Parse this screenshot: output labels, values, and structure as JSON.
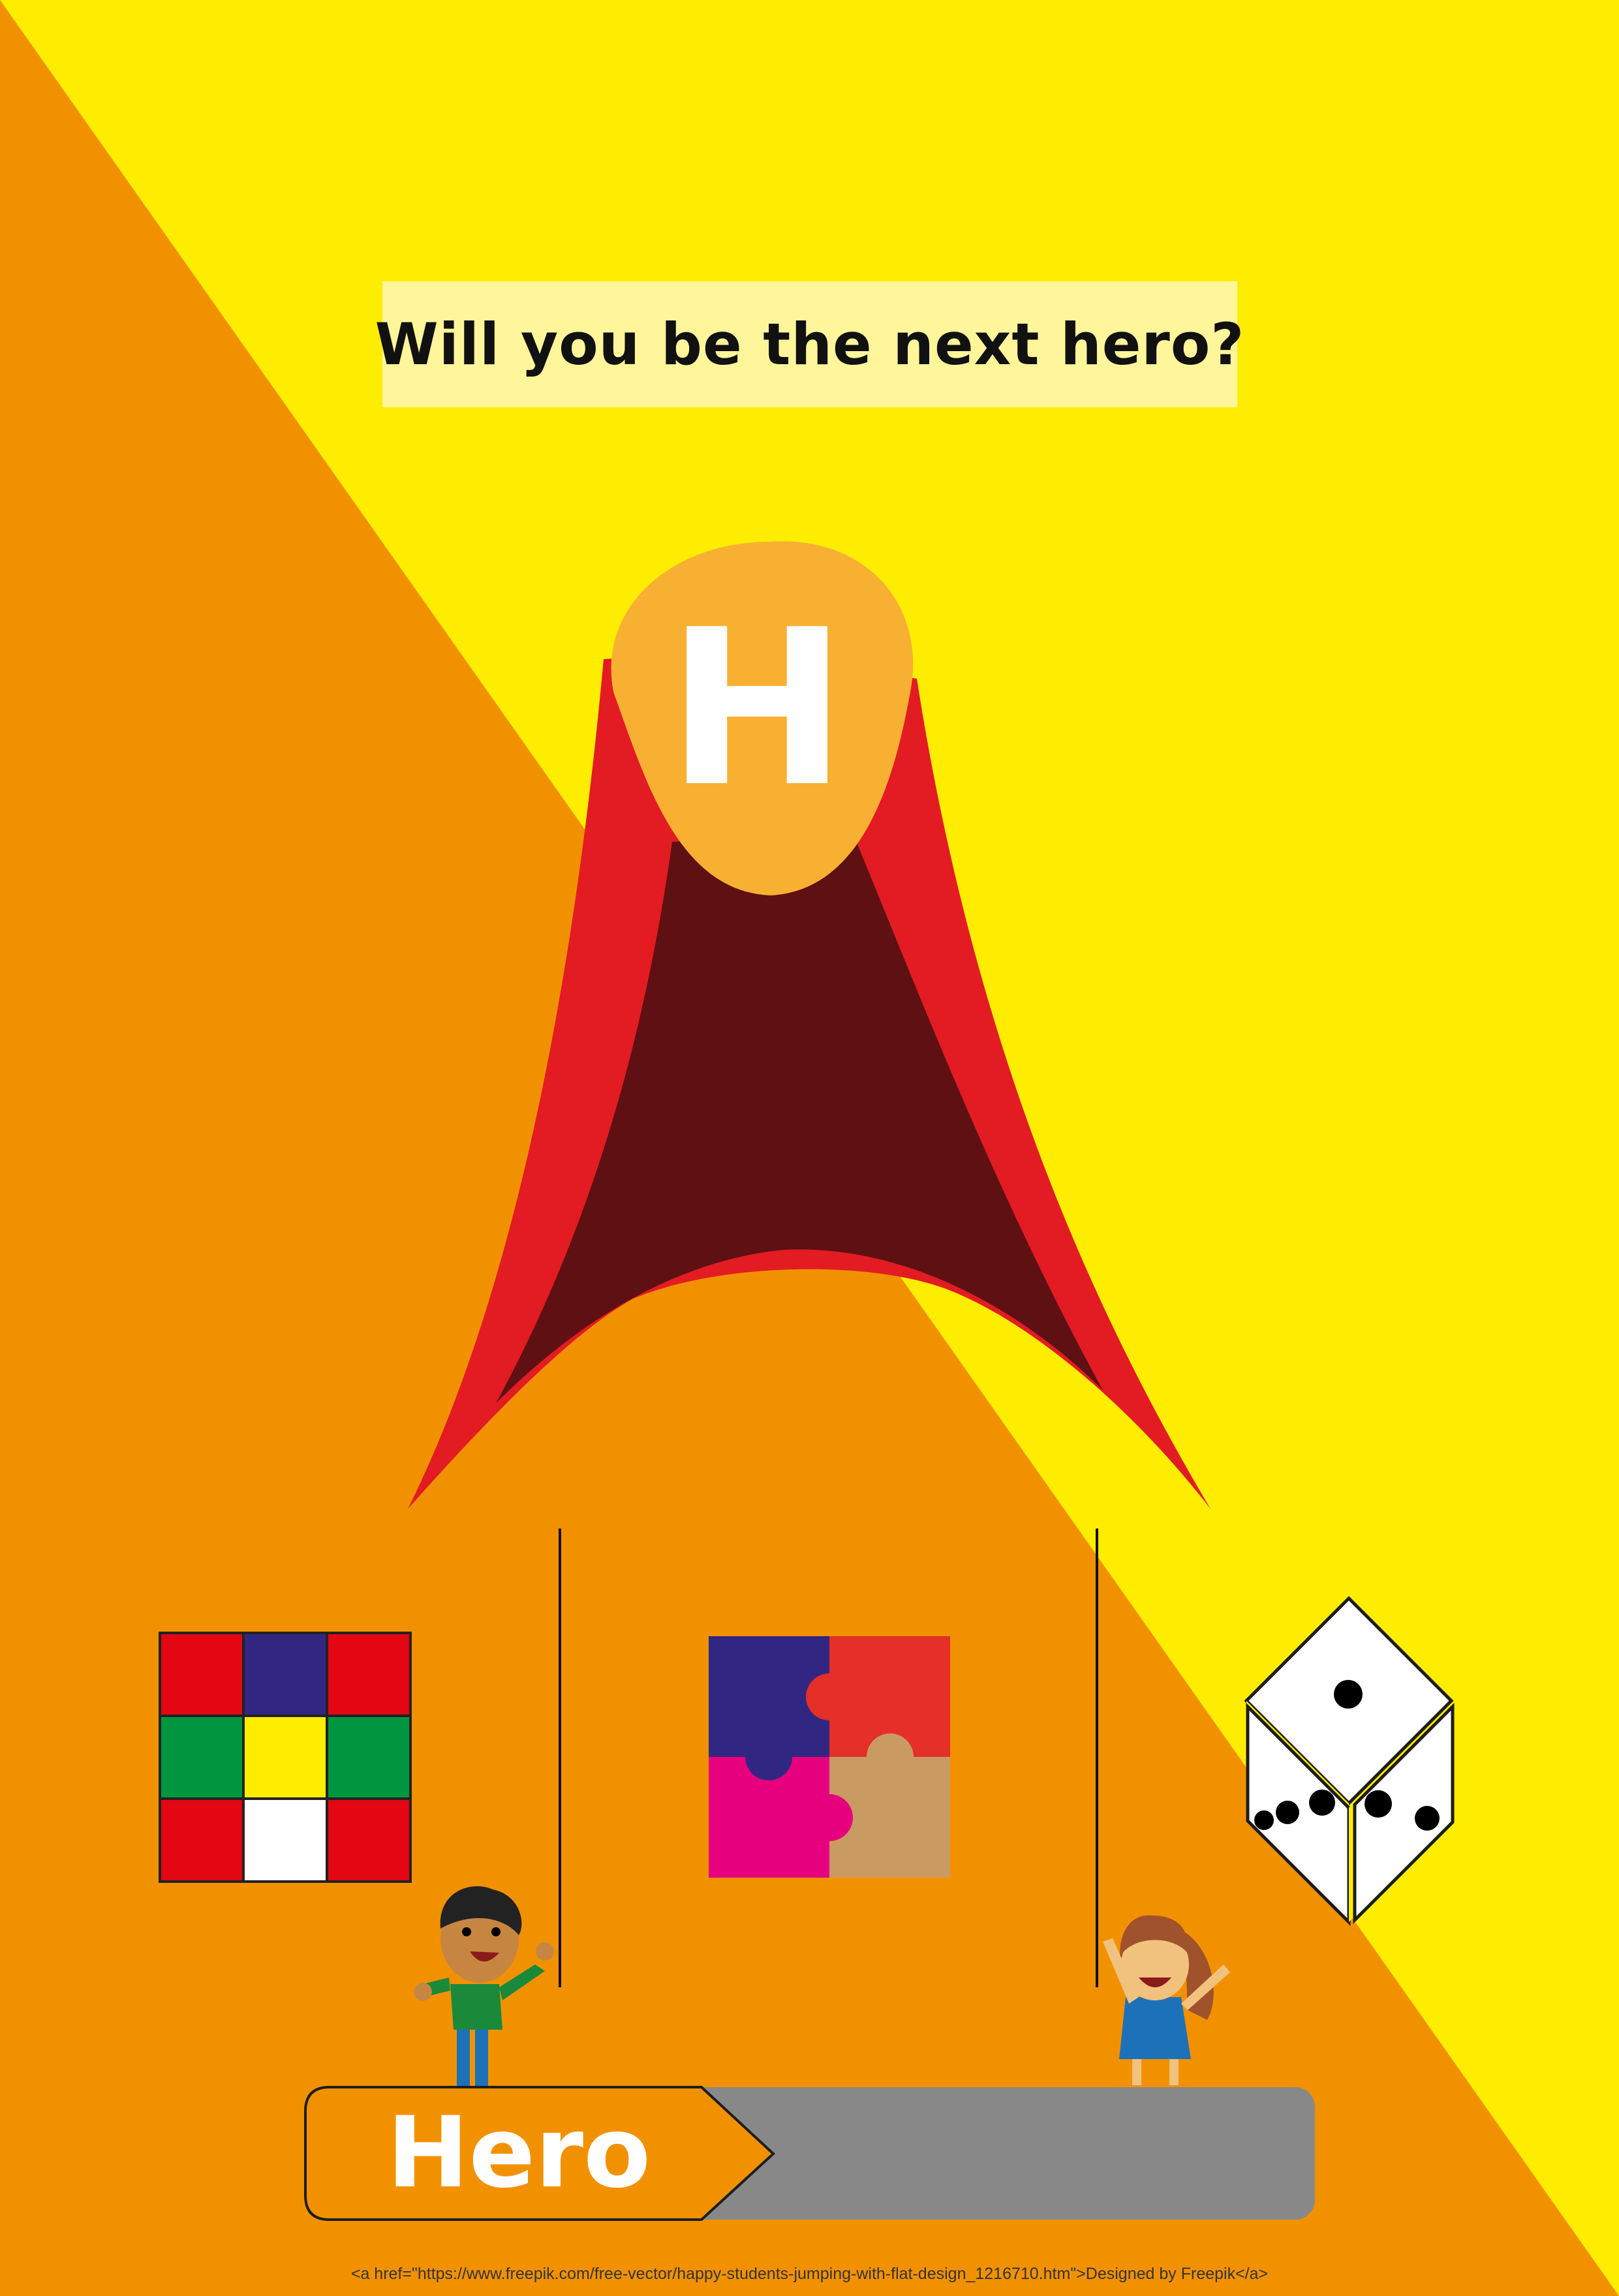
{
  "headline": "Will you be the next hero?",
  "emblem_letter": "H",
  "progress": {
    "label": "Hero",
    "fill_fraction": 0.42
  },
  "credit": "<a href=\"https://www.freepik.com/free-vector/happy-students-jumping-with-flat-design_1216710.htm\">Designed by Freepik</a>",
  "colors": {
    "background_orange": "#f29100",
    "background_yellow": "#ffed00",
    "cape_red": "#e31b23",
    "cape_inner": "#5e1012",
    "emblem": "#f7b032",
    "progress_track": "#888888"
  },
  "icons": [
    "rubik-cube-icon",
    "jigsaw-puzzle-icon",
    "dice-icon",
    "boy-student-icon",
    "girl-student-icon"
  ]
}
